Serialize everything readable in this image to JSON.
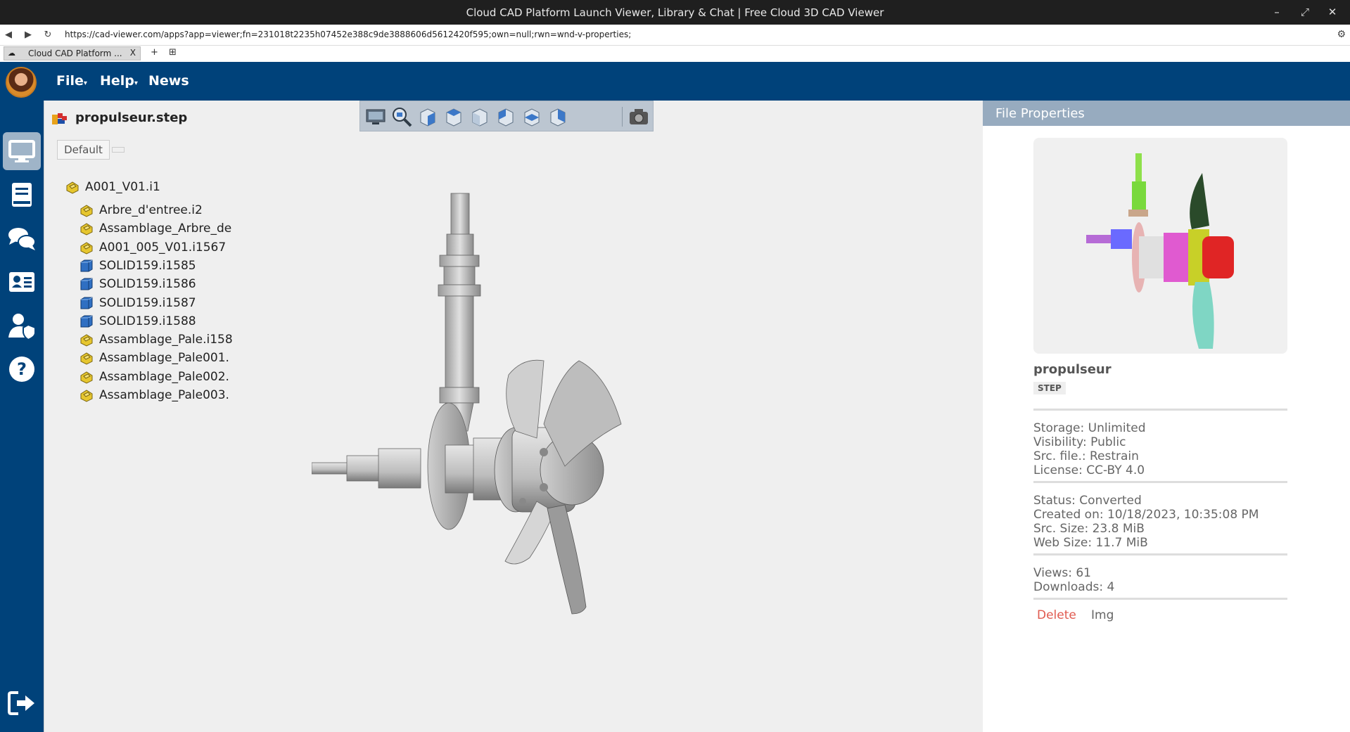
{
  "window": {
    "title": "Cloud CAD Platform Launch Viewer, Library & Chat | Free Cloud 3D CAD Viewer",
    "controls": [
      "–",
      "⤢",
      "✕"
    ]
  },
  "address": {
    "url": "https://cad-viewer.com/apps?app=viewer;fn=231018t2235h07452e388c9de3888606d5612420f595;own=null;rwn=wnd-v-properties;"
  },
  "tab": {
    "label": "Cloud CAD Platform ...",
    "close": "X",
    "new_tab": "+",
    "tab_menu": "⊞"
  },
  "nav": {
    "file": "File",
    "help": "Help",
    "news": "News",
    "caret": "▾"
  },
  "sidebar": {
    "items": [
      {
        "name": "viewer-icon",
        "active": true
      },
      {
        "name": "library-icon",
        "active": false
      },
      {
        "name": "chat-icon",
        "active": false
      },
      {
        "name": "contacts-icon",
        "active": false
      },
      {
        "name": "user-shield-icon",
        "active": false
      },
      {
        "name": "help-icon",
        "active": false
      },
      {
        "name": "logout-icon",
        "active": false
      }
    ]
  },
  "viewer": {
    "filename": "propulseur.step",
    "config_label": "Default",
    "toolbar": [
      "display-mode-icon",
      "zoom-fit-icon",
      "view-iso-icon",
      "view-front-icon",
      "view-back-icon",
      "view-left-icon",
      "view-top-icon",
      "view-right-icon",
      "screenshot-camera-icon"
    ],
    "tree": {
      "root": "A001_V01.i1",
      "children": [
        {
          "label": "Arbre_d'entree.i2",
          "kind": "assembly"
        },
        {
          "label": "Assamblage_Arbre_de",
          "kind": "assembly"
        },
        {
          "label": "A001_005_V01.i1567",
          "kind": "assembly"
        },
        {
          "label": "SOLID159.i1585",
          "kind": "solid"
        },
        {
          "label": "SOLID159.i1586",
          "kind": "solid"
        },
        {
          "label": "SOLID159.i1587",
          "kind": "solid"
        },
        {
          "label": "SOLID159.i1588",
          "kind": "solid"
        },
        {
          "label": "Assamblage_Pale.i158",
          "kind": "assembly"
        },
        {
          "label": "Assamblage_Pale001.",
          "kind": "assembly"
        },
        {
          "label": "Assamblage_Pale002.",
          "kind": "assembly"
        },
        {
          "label": "Assamblage_Pale003.",
          "kind": "assembly"
        }
      ]
    }
  },
  "properties": {
    "header": "File Properties",
    "name": "propulseur",
    "type": "STEP",
    "storage": "Storage: Unlimited",
    "visibility": "Visibility: Public",
    "src_file": "Src. file.: Restrain",
    "license": "License: CC-BY 4.0",
    "status": "Status: Converted",
    "created": "Created on: 10/18/2023, 10:35:08 PM",
    "src_size": "Src. Size: 23.8 MiB",
    "web_size": "Web Size: 11.7 MiB",
    "views": "Views: 61",
    "downloads": "Downloads: 4",
    "delete": "Delete",
    "img": "Img"
  },
  "colors": {
    "brand_blue": "#00427a",
    "panel_header": "#97abbf",
    "delete_red": "#e05a4f"
  }
}
